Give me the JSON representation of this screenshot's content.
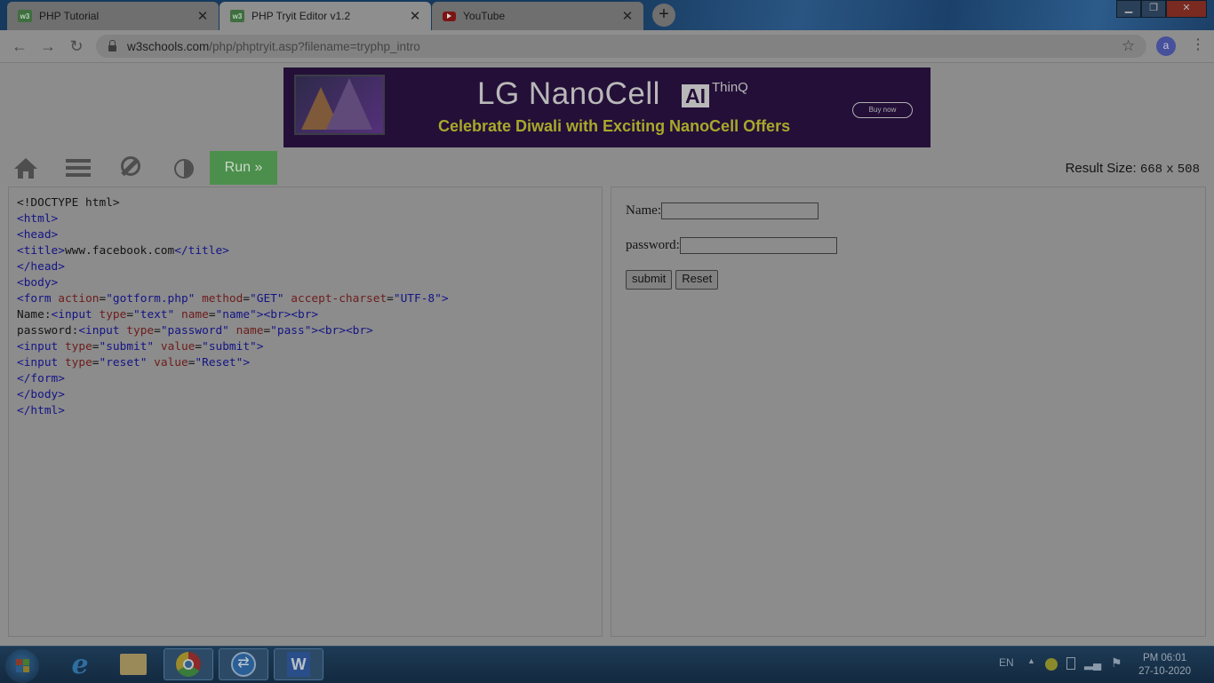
{
  "browser": {
    "tabs": [
      {
        "title": "PHP Tutorial",
        "favicon": "w3schools-icon",
        "active": false
      },
      {
        "title": "PHP Tryit Editor v1.2",
        "favicon": "w3schools-icon",
        "active": true
      },
      {
        "title": "YouTube",
        "favicon": "youtube-icon",
        "active": false
      }
    ],
    "favicon_text": "w3",
    "new_tab": "+",
    "url_host": "w3schools.com",
    "url_path": "/php/phptryit.asp?filename=tryphp_intro",
    "profile_initial": "a"
  },
  "ad": {
    "brand": "LG NanoCell",
    "ai": "AI",
    "thinq": "ThinQ",
    "tagline": "Celebrate Diwali with Exciting NanoCell Offers",
    "cta": "Buy now"
  },
  "toolbar": {
    "run_label": "Run »",
    "result_size_label": "Result Size:",
    "result_width": "668",
    "result_x": "x",
    "result_height": "508"
  },
  "code": {
    "doctype": "<!DOCTYPE html>",
    "html_open": "<html>",
    "head_open": "<head>",
    "title_open": "<title>",
    "title_text": "www.facebook.com",
    "title_close": "</title>",
    "head_close": "</head>",
    "body_open": "<body>",
    "form_tag": "<form",
    "action_attr": "action",
    "action_val": "\"gotform.php\"",
    "method_attr": "method",
    "method_val": "\"GET\"",
    "charset_attr": "accept-charset",
    "charset_val": "\"UTF-8\"",
    "name_label": "Name:",
    "password_label": "password:",
    "input_tag": "<input",
    "type_attr": "type",
    "name_attr": "name",
    "value_attr": "value",
    "type_text": "\"text\"",
    "name_name": "\"name\"",
    "type_password": "\"password\"",
    "name_pass": "\"pass\"",
    "type_submit": "\"submit\"",
    "value_submit": "\"submit\"",
    "type_reset": "\"reset\"",
    "value_reset": "\"Reset\"",
    "br": "<br>",
    "gt": ">",
    "eq": "=",
    "form_close": "</form>",
    "body_close": "</body>",
    "html_close": "</html>"
  },
  "result": {
    "name_label": "Name:",
    "password_label": "password:",
    "submit_label": "submit",
    "reset_label": "Reset"
  },
  "taskbar": {
    "apps": [
      "windows-explorer-icon",
      "internet-explorer-icon",
      "file-manager-icon",
      "chrome-icon",
      "teamviewer-icon",
      "word-icon"
    ],
    "language": "EN",
    "time": "PM 06:01",
    "date": "27-10-2020"
  },
  "colors": {
    "run_button": "#4c8f4c",
    "tag": "#141486",
    "attribute": "#6e1c1c"
  }
}
